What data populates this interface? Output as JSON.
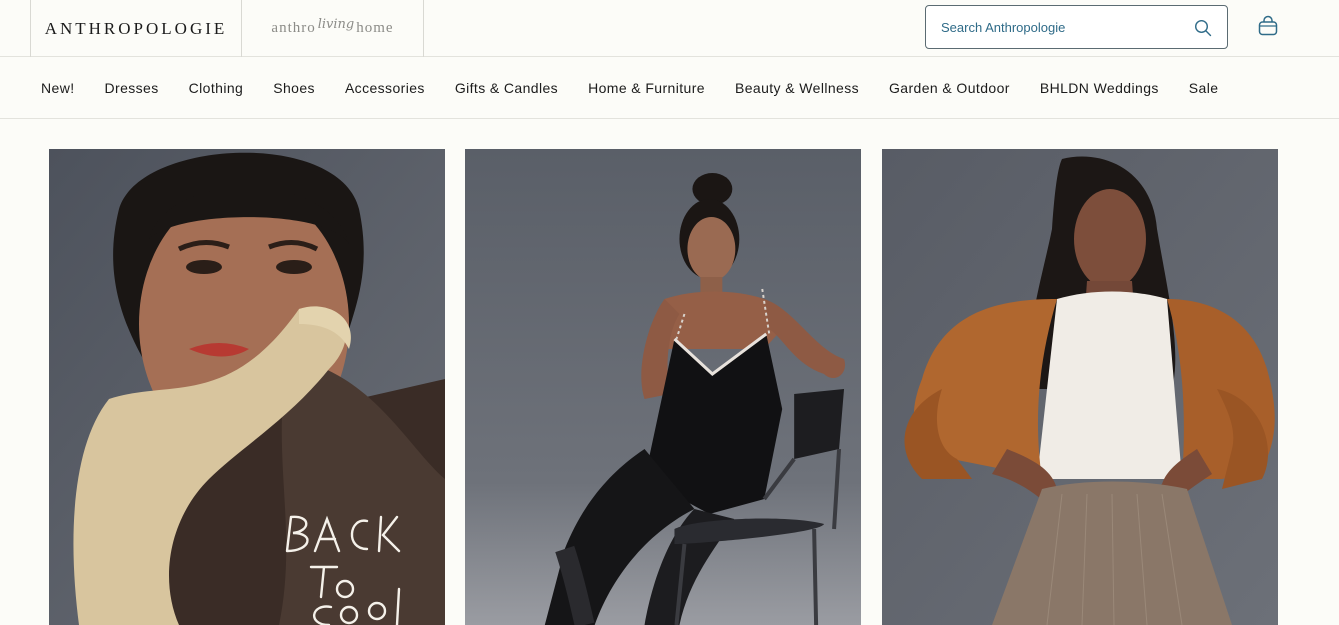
{
  "header": {
    "brand": "ANTHROPOLOGIE",
    "living_home": {
      "word1": "anthro",
      "word2": "living",
      "word3": "home"
    },
    "search": {
      "placeholder": "Search Anthropologie",
      "icon": "search-icon"
    },
    "cart_icon": "shopping-bag-icon"
  },
  "nav": {
    "items": [
      {
        "label": "New!"
      },
      {
        "label": "Dresses"
      },
      {
        "label": "Clothing"
      },
      {
        "label": "Shoes"
      },
      {
        "label": "Accessories"
      },
      {
        "label": "Gifts & Candles"
      },
      {
        "label": "Home & Furniture"
      },
      {
        "label": "Beauty & Wellness"
      },
      {
        "label": "Garden & Outdoor"
      },
      {
        "label": "BHLDN Weddings"
      },
      {
        "label": "Sale"
      }
    ]
  },
  "hero": {
    "tiles": [
      {
        "overlay_text": [
          "BACK",
          "To",
          "Cool"
        ]
      },
      {},
      {}
    ]
  },
  "colors": {
    "background": "#fcfcf8",
    "accent": "#2f6b88",
    "photo_backdrop": "#5a5e66"
  }
}
